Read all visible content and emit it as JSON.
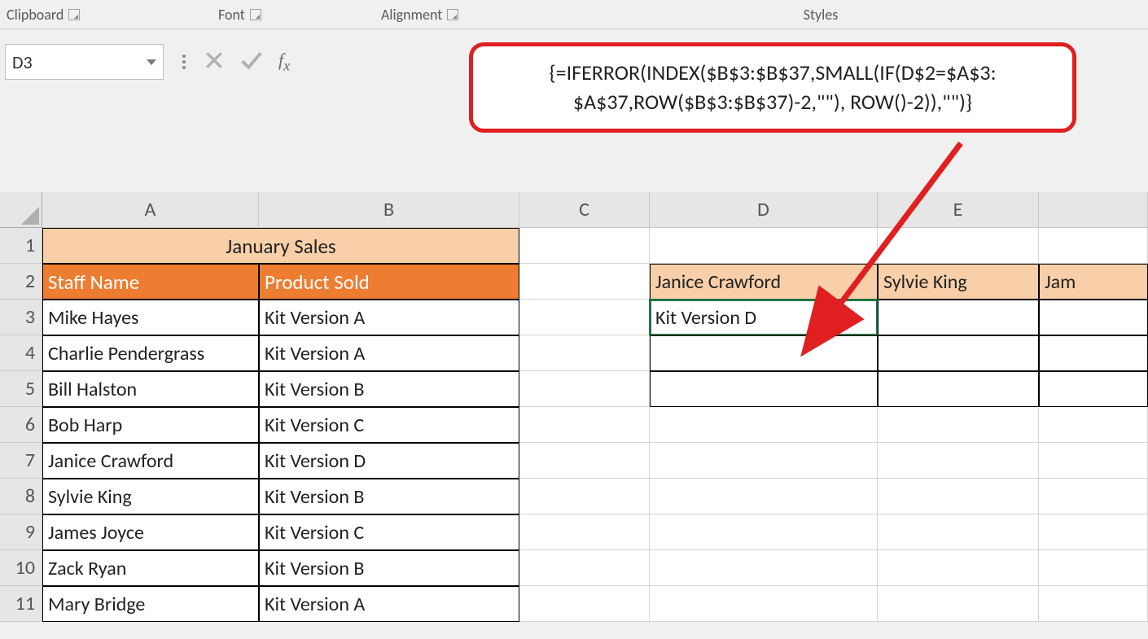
{
  "ribbon": {
    "clipboard": "Clipboard",
    "font": "Font",
    "alignment": "Alignment",
    "styles": "Styles"
  },
  "formula_bar": {
    "cell_ref": "D3",
    "formula_line1": "{=IFERROR(INDEX($B$3:$B$37,SMALL(IF(D$2=$A$3:",
    "formula_line2": "$A$37,ROW($B$3:$B$37)-2,\"\"), ROW()-2)),\"\")}"
  },
  "columns": [
    "A",
    "B",
    "C",
    "D",
    "E"
  ],
  "rows": [
    "1",
    "2",
    "3",
    "4",
    "5",
    "6",
    "7",
    "8",
    "9",
    "10",
    "11"
  ],
  "sheet": {
    "title": "January Sales",
    "header_a": "Staff Name",
    "header_b": "Product Sold",
    "data": [
      {
        "a": "Mike Hayes",
        "b": "Kit Version A"
      },
      {
        "a": "Charlie Pendergrass",
        "b": "Kit Version A"
      },
      {
        "a": "Bill Halston",
        "b": "Kit Version B"
      },
      {
        "a": "Bob Harp",
        "b": "Kit Version C"
      },
      {
        "a": "Janice Crawford",
        "b": "Kit Version D"
      },
      {
        "a": "Sylvie King",
        "b": "Kit Version B"
      },
      {
        "a": "James Joyce",
        "b": "Kit Version C"
      },
      {
        "a": "Zack Ryan",
        "b": "Kit Version B"
      },
      {
        "a": "Mary Bridge",
        "b": "Kit Version A"
      }
    ]
  },
  "lookup": {
    "d2": "Janice Crawford",
    "e2": "Sylvie King",
    "f2_partial": "Jam",
    "d3": "Kit Version D"
  }
}
